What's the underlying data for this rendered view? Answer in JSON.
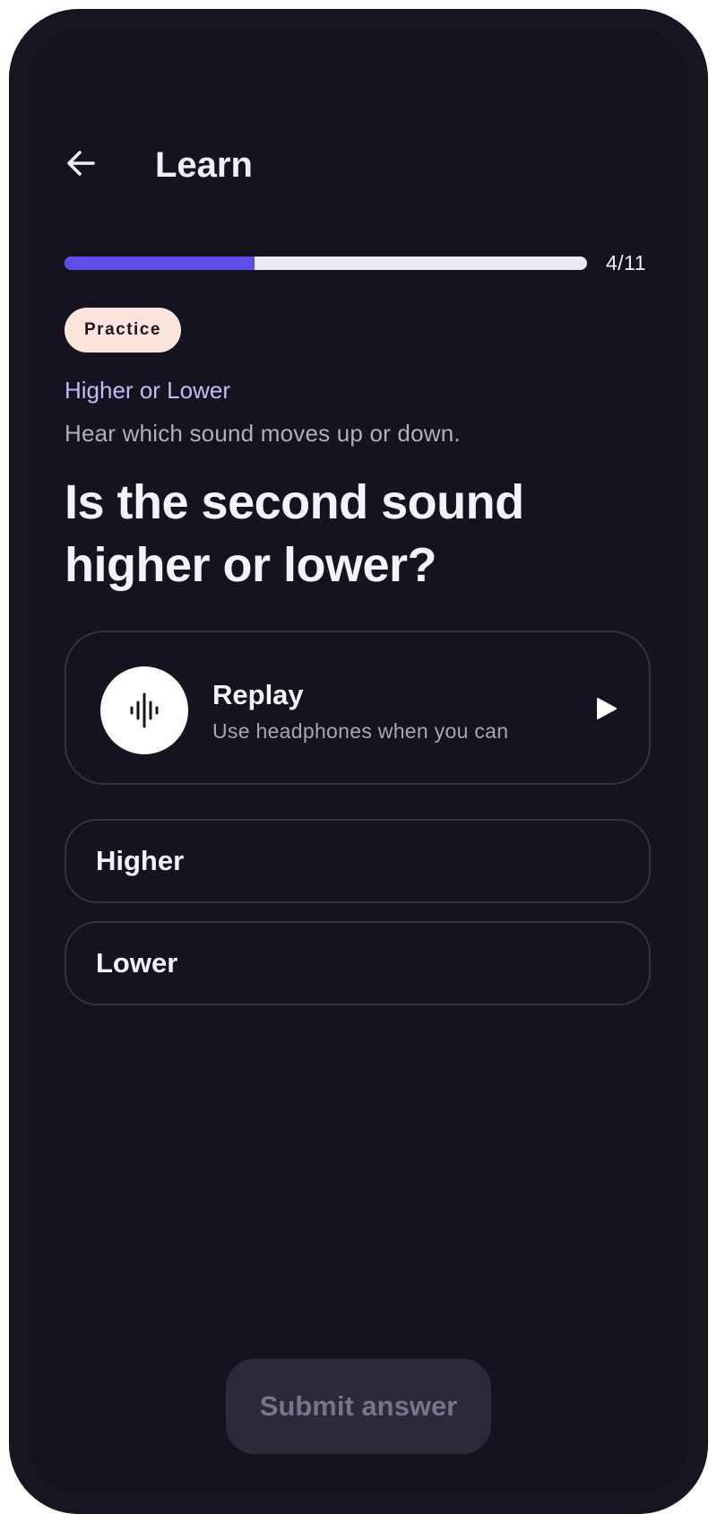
{
  "header": {
    "title": "Learn",
    "back_icon": "arrow-left-icon"
  },
  "progress": {
    "current": 4,
    "total": 11,
    "label": "4/11",
    "fill_color": "#5a4de8",
    "track_color": "#ebe9f4"
  },
  "badge": {
    "label": "Practice",
    "bg_color": "#fde4dc"
  },
  "lesson": {
    "eyebrow": "Higher or Lower",
    "subtitle": "Hear which sound moves up or down.",
    "question": "Is the second sound higher or lower?"
  },
  "replay": {
    "label": "Replay",
    "hint": "Use headphones when you can",
    "wave_icon": "sound-wave-icon",
    "play_icon": "play-icon"
  },
  "options": [
    {
      "label": "Higher"
    },
    {
      "label": "Lower"
    }
  ],
  "submit": {
    "label": "Submit answer",
    "enabled": false
  },
  "colors": {
    "background": "#14131f",
    "accent": "#5a4de8",
    "eyebrow": "#c7b9f4"
  }
}
